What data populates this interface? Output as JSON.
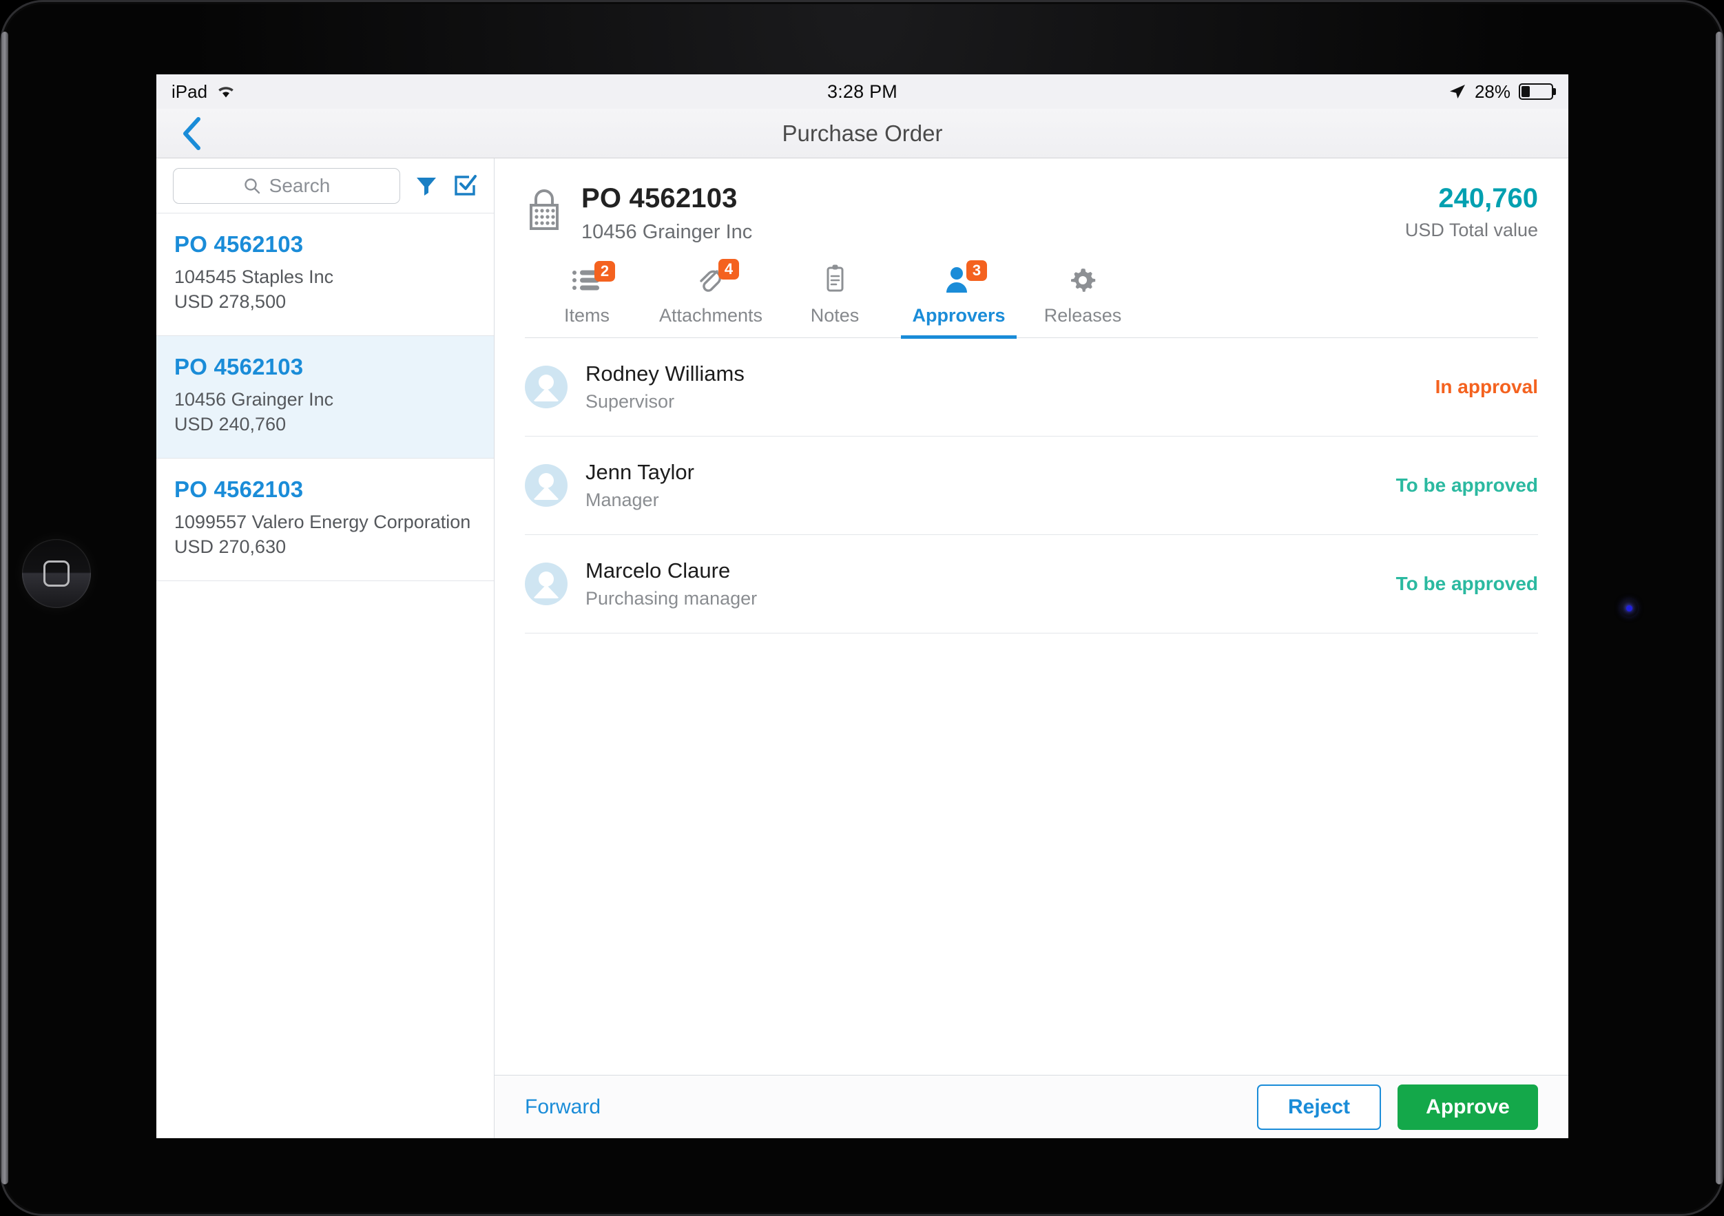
{
  "status_bar": {
    "device_label": "iPad",
    "wifi_icon": "wifi-icon",
    "time": "3:28 PM",
    "location_icon": "location-arrow-icon",
    "battery_percent": "28%",
    "battery_level": 28
  },
  "nav": {
    "back_icon": "chevron-left-icon",
    "title": "Purchase Order"
  },
  "master": {
    "search": {
      "icon": "search-icon",
      "placeholder": "Search",
      "value": ""
    },
    "filter_icon": "filter-funnel-icon",
    "select_icon": "checkbox-checked-icon",
    "items": [
      {
        "id": "PO 4562103",
        "vendor": "104545 Staples Inc",
        "amount": "USD 278,500",
        "selected": false
      },
      {
        "id": "PO 4562103",
        "vendor": "10456 Grainger Inc",
        "amount": "USD 240,760",
        "selected": true
      },
      {
        "id": "PO 4562103",
        "vendor": "1099557 Valero Energy Corporation",
        "amount": "USD 270,630",
        "selected": false
      }
    ]
  },
  "detail": {
    "header": {
      "icon": "shopping-basket-icon",
      "title": "PO 4562103",
      "subtitle": "10456 Grainger Inc",
      "total_value": "240,760",
      "total_value_label": "USD Total value"
    },
    "tabs": [
      {
        "label": "Items",
        "icon": "list-icon",
        "badge": "2",
        "active": false
      },
      {
        "label": "Attachments",
        "icon": "paperclip-icon",
        "badge": "4",
        "active": false
      },
      {
        "label": "Notes",
        "icon": "clipboard-icon",
        "badge": "",
        "active": false
      },
      {
        "label": "Approvers",
        "icon": "person-icon",
        "badge": "3",
        "active": true
      },
      {
        "label": "Releases",
        "icon": "gear-icon",
        "badge": "",
        "active": false
      }
    ],
    "approvers": [
      {
        "name": "Rodney Williams",
        "role": "Supervisor",
        "status": "In approval",
        "status_color": "#f4621f",
        "avatar": "avatar-placeholder-icon"
      },
      {
        "name": "Jenn Taylor",
        "role": "Manager",
        "status": "To be approved",
        "status_color": "#2bb9a0",
        "avatar": "avatar-placeholder-icon"
      },
      {
        "name": "Marcelo Claure",
        "role": "Purchasing manager",
        "status": "To be approved",
        "status_color": "#2bb9a0",
        "avatar": "avatar-placeholder-icon"
      }
    ],
    "footer": {
      "forward_label": "Forward",
      "reject_label": "Reject",
      "approve_label": "Approve"
    }
  },
  "colors": {
    "accent_blue": "#1a8cd8",
    "teal": "#00a0b0",
    "orange_badge": "#f4621f",
    "green_approve": "#14a84a",
    "status_green": "#2bb9a0",
    "selected_row_bg": "#eaf4fb"
  }
}
